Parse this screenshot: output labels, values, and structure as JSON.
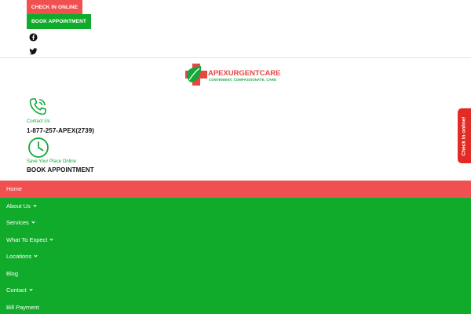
{
  "header": {
    "checkin_button": "Check in online",
    "book_button": "Book appointment",
    "social": [
      "facebook-icon",
      "twitter-icon"
    ]
  },
  "logo": {
    "name": "APEXURGENTCARE",
    "tagline": "Convenient, Compassionate, Care"
  },
  "contact": {
    "label": "Contact Us",
    "phone": "1-877-257-APEX(2739)"
  },
  "booking": {
    "label": "Save Your Place Online",
    "text": "BOOK APPOINTMENT"
  },
  "side_tab": {
    "label": "Check in online!"
  },
  "nav": {
    "items": [
      {
        "label": "Home",
        "active": true
      },
      {
        "label": "About Us",
        "dropdown": true
      },
      {
        "label": "Services",
        "dropdown": true
      },
      {
        "label": "What To Expect",
        "dropdown": true
      },
      {
        "label": "Locations",
        "dropdown": true
      },
      {
        "label": "Blog"
      },
      {
        "label": "Contact",
        "dropdown": true
      },
      {
        "label": "Bill Payment"
      }
    ]
  },
  "colors": {
    "red": "#f05150",
    "green": "#11ab2b"
  }
}
